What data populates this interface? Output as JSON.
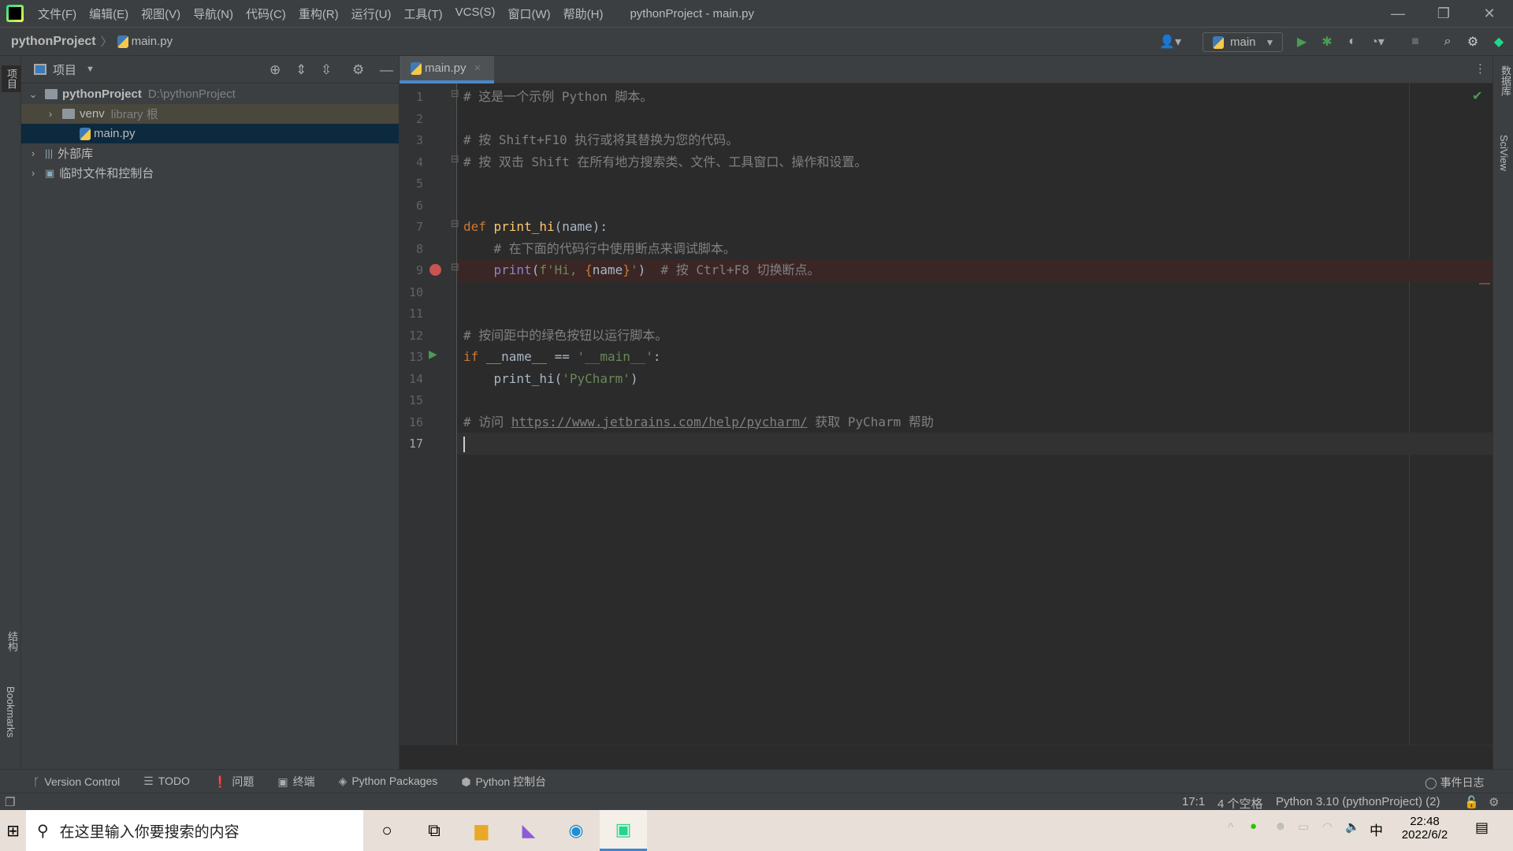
{
  "menu": [
    "文件(F)",
    "编辑(E)",
    "视图(V)",
    "导航(N)",
    "代码(C)",
    "重构(R)",
    "运行(U)",
    "工具(T)",
    "VCS(S)",
    "窗口(W)",
    "帮助(H)"
  ],
  "window_title": "pythonProject - main.py",
  "nav": {
    "project": "pythonProject",
    "file": "main.py",
    "run_config": "main"
  },
  "left_strip": {
    "project": "项目",
    "structure": "结构",
    "bookmarks": "Bookmarks"
  },
  "right_strip": {
    "database": "数据库",
    "sciview": "SciView"
  },
  "project_panel": {
    "title": "项目",
    "tree": [
      {
        "label": "pythonProject",
        "hint": "D:\\pythonProject",
        "expanded": true,
        "level": 0,
        "icon": "folder-icon"
      },
      {
        "label": "venv",
        "hint": "library 根",
        "expanded": false,
        "level": 1,
        "icon": "folder-icon"
      },
      {
        "label": "main.py",
        "hint": "",
        "level": 2,
        "icon": "python-file-icon",
        "selected": true
      },
      {
        "label": "外部库",
        "hint": "",
        "expanded": false,
        "level": 0,
        "icon": "library-icon"
      },
      {
        "label": "临时文件和控制台",
        "hint": "",
        "expanded": false,
        "level": 0,
        "icon": "scratch-icon"
      }
    ]
  },
  "editor": {
    "tab": "main.py",
    "current_line": 17,
    "breakpoint_line": 9,
    "run_line": 13,
    "lines": [
      [
        [
          "# 这是一个示例 Python 脚本。",
          "c"
        ]
      ],
      [],
      [
        [
          "# 按 Shift+F10 执行或将其替换为您的代码。",
          "c"
        ]
      ],
      [
        [
          "# 按 双击 Shift 在所有地方搜索类、文件、工具窗口、操作和设置。",
          "c"
        ]
      ],
      [],
      [],
      [
        [
          "def ",
          "k"
        ],
        [
          "print_hi",
          "f"
        ],
        [
          "(name):",
          "n"
        ]
      ],
      [
        [
          "    # 在下面的代码行中使用断点来调试脚本。",
          "c"
        ]
      ],
      [
        [
          "    ",
          "n"
        ],
        [
          "print",
          "bi"
        ],
        [
          "(",
          "n"
        ],
        [
          "f'Hi, ",
          "s"
        ],
        [
          "{",
          "b"
        ],
        [
          "name",
          "n"
        ],
        [
          "}",
          "b"
        ],
        [
          "'",
          "s"
        ],
        [
          ")  ",
          "n"
        ],
        [
          "# 按 Ctrl+F8 切换断点。",
          "c"
        ]
      ],
      [],
      [],
      [
        [
          "# 按间距中的绿色按钮以运行脚本。",
          "c"
        ]
      ],
      [
        [
          "if ",
          "k"
        ],
        [
          "__name__ == ",
          "n"
        ],
        [
          "'__main__'",
          "s"
        ],
        [
          ":",
          "n"
        ]
      ],
      [
        [
          "    print_hi(",
          "n"
        ],
        [
          "'PyCharm'",
          "s"
        ],
        [
          ")",
          "n"
        ]
      ],
      [],
      [
        [
          "# 访问 ",
          "c"
        ],
        [
          "https://www.jetbrains.com/help/pycharm/",
          "u"
        ],
        [
          " 获取 PyCharm 帮助",
          "c"
        ]
      ],
      []
    ]
  },
  "tool_windows": [
    "Version Control",
    "TODO",
    "问题",
    "终端",
    "Python Packages",
    "Python 控制台"
  ],
  "event_log": "事件日志",
  "status": {
    "position": "17:1",
    "indent": "4 个空格",
    "interpreter": "Python 3.10 (pythonProject) (2)"
  },
  "taskbar": {
    "search_placeholder": "在这里输入你要搜索的内容",
    "time": "22:48",
    "date": "2022/6/2",
    "ime": "中"
  },
  "colors": {
    "editor_bg": "#2b2b2b",
    "panel_bg": "#3c3f41",
    "selection": "#0d293e",
    "accent": "#4a88c7",
    "breakpoint": "#c75450",
    "run": "#499c54"
  }
}
